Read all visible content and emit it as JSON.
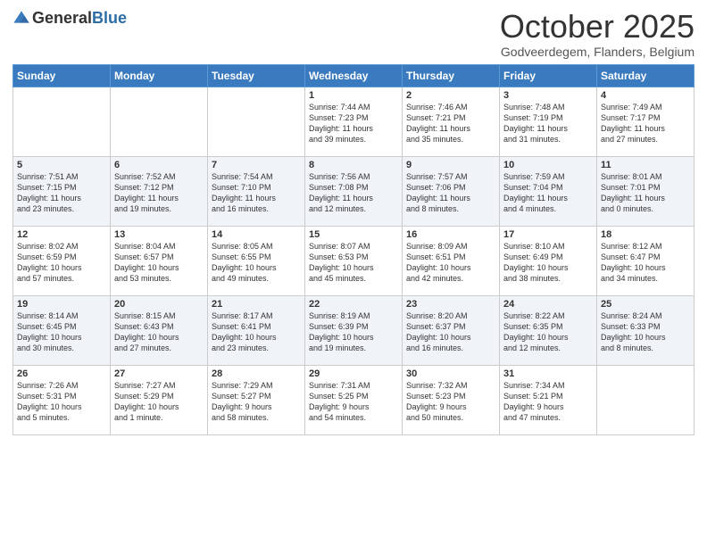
{
  "logo": {
    "general": "General",
    "blue": "Blue"
  },
  "header": {
    "month": "October 2025",
    "location": "Godveerdegem, Flanders, Belgium"
  },
  "days_of_week": [
    "Sunday",
    "Monday",
    "Tuesday",
    "Wednesday",
    "Thursday",
    "Friday",
    "Saturday"
  ],
  "weeks": [
    [
      {
        "day": "",
        "info": ""
      },
      {
        "day": "",
        "info": ""
      },
      {
        "day": "",
        "info": ""
      },
      {
        "day": "1",
        "info": "Sunrise: 7:44 AM\nSunset: 7:23 PM\nDaylight: 11 hours\nand 39 minutes."
      },
      {
        "day": "2",
        "info": "Sunrise: 7:46 AM\nSunset: 7:21 PM\nDaylight: 11 hours\nand 35 minutes."
      },
      {
        "day": "3",
        "info": "Sunrise: 7:48 AM\nSunset: 7:19 PM\nDaylight: 11 hours\nand 31 minutes."
      },
      {
        "day": "4",
        "info": "Sunrise: 7:49 AM\nSunset: 7:17 PM\nDaylight: 11 hours\nand 27 minutes."
      }
    ],
    [
      {
        "day": "5",
        "info": "Sunrise: 7:51 AM\nSunset: 7:15 PM\nDaylight: 11 hours\nand 23 minutes."
      },
      {
        "day": "6",
        "info": "Sunrise: 7:52 AM\nSunset: 7:12 PM\nDaylight: 11 hours\nand 19 minutes."
      },
      {
        "day": "7",
        "info": "Sunrise: 7:54 AM\nSunset: 7:10 PM\nDaylight: 11 hours\nand 16 minutes."
      },
      {
        "day": "8",
        "info": "Sunrise: 7:56 AM\nSunset: 7:08 PM\nDaylight: 11 hours\nand 12 minutes."
      },
      {
        "day": "9",
        "info": "Sunrise: 7:57 AM\nSunset: 7:06 PM\nDaylight: 11 hours\nand 8 minutes."
      },
      {
        "day": "10",
        "info": "Sunrise: 7:59 AM\nSunset: 7:04 PM\nDaylight: 11 hours\nand 4 minutes."
      },
      {
        "day": "11",
        "info": "Sunrise: 8:01 AM\nSunset: 7:01 PM\nDaylight: 11 hours\nand 0 minutes."
      }
    ],
    [
      {
        "day": "12",
        "info": "Sunrise: 8:02 AM\nSunset: 6:59 PM\nDaylight: 10 hours\nand 57 minutes."
      },
      {
        "day": "13",
        "info": "Sunrise: 8:04 AM\nSunset: 6:57 PM\nDaylight: 10 hours\nand 53 minutes."
      },
      {
        "day": "14",
        "info": "Sunrise: 8:05 AM\nSunset: 6:55 PM\nDaylight: 10 hours\nand 49 minutes."
      },
      {
        "day": "15",
        "info": "Sunrise: 8:07 AM\nSunset: 6:53 PM\nDaylight: 10 hours\nand 45 minutes."
      },
      {
        "day": "16",
        "info": "Sunrise: 8:09 AM\nSunset: 6:51 PM\nDaylight: 10 hours\nand 42 minutes."
      },
      {
        "day": "17",
        "info": "Sunrise: 8:10 AM\nSunset: 6:49 PM\nDaylight: 10 hours\nand 38 minutes."
      },
      {
        "day": "18",
        "info": "Sunrise: 8:12 AM\nSunset: 6:47 PM\nDaylight: 10 hours\nand 34 minutes."
      }
    ],
    [
      {
        "day": "19",
        "info": "Sunrise: 8:14 AM\nSunset: 6:45 PM\nDaylight: 10 hours\nand 30 minutes."
      },
      {
        "day": "20",
        "info": "Sunrise: 8:15 AM\nSunset: 6:43 PM\nDaylight: 10 hours\nand 27 minutes."
      },
      {
        "day": "21",
        "info": "Sunrise: 8:17 AM\nSunset: 6:41 PM\nDaylight: 10 hours\nand 23 minutes."
      },
      {
        "day": "22",
        "info": "Sunrise: 8:19 AM\nSunset: 6:39 PM\nDaylight: 10 hours\nand 19 minutes."
      },
      {
        "day": "23",
        "info": "Sunrise: 8:20 AM\nSunset: 6:37 PM\nDaylight: 10 hours\nand 16 minutes."
      },
      {
        "day": "24",
        "info": "Sunrise: 8:22 AM\nSunset: 6:35 PM\nDaylight: 10 hours\nand 12 minutes."
      },
      {
        "day": "25",
        "info": "Sunrise: 8:24 AM\nSunset: 6:33 PM\nDaylight: 10 hours\nand 8 minutes."
      }
    ],
    [
      {
        "day": "26",
        "info": "Sunrise: 7:26 AM\nSunset: 5:31 PM\nDaylight: 10 hours\nand 5 minutes."
      },
      {
        "day": "27",
        "info": "Sunrise: 7:27 AM\nSunset: 5:29 PM\nDaylight: 10 hours\nand 1 minute."
      },
      {
        "day": "28",
        "info": "Sunrise: 7:29 AM\nSunset: 5:27 PM\nDaylight: 9 hours\nand 58 minutes."
      },
      {
        "day": "29",
        "info": "Sunrise: 7:31 AM\nSunset: 5:25 PM\nDaylight: 9 hours\nand 54 minutes."
      },
      {
        "day": "30",
        "info": "Sunrise: 7:32 AM\nSunset: 5:23 PM\nDaylight: 9 hours\nand 50 minutes."
      },
      {
        "day": "31",
        "info": "Sunrise: 7:34 AM\nSunset: 5:21 PM\nDaylight: 9 hours\nand 47 minutes."
      },
      {
        "day": "",
        "info": ""
      }
    ]
  ]
}
